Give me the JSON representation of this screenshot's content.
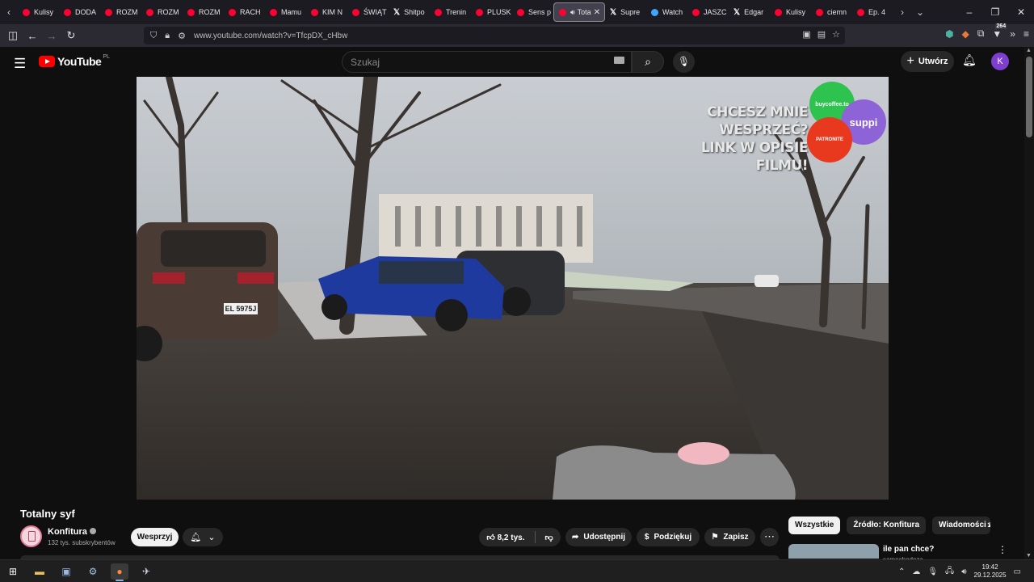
{
  "browser": {
    "tabs": [
      {
        "label": "Kulisy",
        "icon": "youtube-icon"
      },
      {
        "label": "DODA",
        "icon": "youtube-icon"
      },
      {
        "label": "ROZM",
        "icon": "youtube-icon"
      },
      {
        "label": "ROZM",
        "icon": "youtube-icon"
      },
      {
        "label": "ROZM",
        "icon": "youtube-icon"
      },
      {
        "label": "RACH",
        "icon": "youtube-icon"
      },
      {
        "label": "Mamu",
        "icon": "youtube-icon"
      },
      {
        "label": "KIM N",
        "icon": "youtube-icon"
      },
      {
        "label": "ŚWIĄT",
        "icon": "youtube-icon"
      },
      {
        "label": "Shitpo",
        "icon": "x-icon"
      },
      {
        "label": "Trenin",
        "icon": "youtube-icon"
      },
      {
        "label": "PLUSK",
        "icon": "youtube-icon"
      },
      {
        "label": "Sens p",
        "icon": "youtube-icon"
      },
      {
        "label": "Tota",
        "icon": "youtube-icon",
        "active": true
      },
      {
        "label": "Supre",
        "icon": "x-icon"
      },
      {
        "label": "Watch",
        "icon": "watch-icon"
      },
      {
        "label": "JASZC",
        "icon": "youtube-icon"
      },
      {
        "label": "Edgar",
        "icon": "x-icon"
      },
      {
        "label": "Kulisy",
        "icon": "youtube-icon"
      },
      {
        "label": "ciemn",
        "icon": "youtube-icon"
      },
      {
        "label": "Ep. 4",
        "icon": "youtube-icon"
      }
    ],
    "url": "www.youtube.com/watch?v=TfcpDX_cHbw",
    "extension_badge": "264"
  },
  "youtube": {
    "logo_text": "YouTube",
    "region": "PL",
    "search_placeholder": "Szukaj",
    "create_label": "Utwórz",
    "avatar_letter": "K"
  },
  "video": {
    "overlay_line1": "CHCESZ MNIE WESPRZEĆ?",
    "overlay_line2": "LINK W OPISIE FILMU!",
    "circle_green": "buycoffee.to",
    "circle_purple": "suppi",
    "circle_red": "PATRONITE",
    "plate": "EL 5975J",
    "title": "Totalny syf"
  },
  "channel": {
    "name": "Konfitura",
    "subscribers": "132 tys. subskrybentów",
    "support_label": "Wesprzyj"
  },
  "actions": {
    "likes": "8,2 tys.",
    "share": "Udostępnij",
    "thanks": "Podziękuj",
    "save": "Zapisz"
  },
  "chips": [
    "Wszystkie",
    "Źródło: Konfitura",
    "Wiadomości ze ś"
  ],
  "recommendation": {
    "title": "ile pan chce?",
    "channel": "samochodoza"
  },
  "taskbar": {
    "time": "19:42",
    "date": "29.12.2025"
  }
}
